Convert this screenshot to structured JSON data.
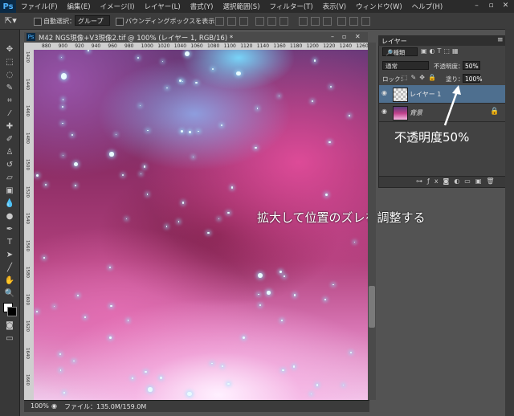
{
  "app": {
    "logo": "Ps"
  },
  "menubar": {
    "items": [
      "ファイル(F)",
      "編集(E)",
      "イメージ(I)",
      "レイヤー(L)",
      "書式(Y)",
      "選択範囲(S)",
      "フィルター(T)",
      "表示(V)",
      "ウィンドウ(W)",
      "ヘルプ(H)"
    ],
    "window_controls": [
      "–",
      "▫",
      "✕"
    ]
  },
  "options_bar": {
    "auto_select_label": "自動選択：",
    "auto_select_value": "グループ",
    "bounding_box_label": "バウンディングボックスを表示"
  },
  "document": {
    "tab_icon": "Ps",
    "title": "M42 NGS現像+V3現像2.tif @ 100% (レイヤー 1, RGB/16) *",
    "ruler_top_ticks": [
      "880",
      "900",
      "920",
      "940",
      "960",
      "980",
      "1000",
      "1020",
      "1040",
      "1060",
      "1080",
      "1100",
      "1120",
      "1140",
      "1160",
      "1180",
      "1200",
      "1220",
      "1240",
      "1260"
    ],
    "ruler_left_ticks": [
      "1420",
      "1440",
      "1460",
      "1480",
      "1500",
      "1520",
      "1540",
      "1560",
      "1580",
      "1600",
      "1620",
      "1640",
      "1660"
    ],
    "zoom": "100%",
    "file_info": "ファイル：135.0M/159.0M",
    "annotation": "拡大して位置のズレを調整する"
  },
  "layers_panel": {
    "tab_label": "レイヤー",
    "kind_filter": "種類",
    "blend_mode": "通常",
    "opacity_label": "不透明度：",
    "opacity_value": "50%",
    "lock_label": "ロック：",
    "fill_label": "塗り：",
    "fill_value": "100%",
    "layers": [
      {
        "name": "レイヤー 1",
        "selected": true
      },
      {
        "name": "背景",
        "selected": false,
        "locked": true
      }
    ],
    "annotation": "不透明度50%"
  },
  "colors": {
    "accent_selected": "#4e6f8f",
    "ps_blue": "#4fb3ff"
  }
}
